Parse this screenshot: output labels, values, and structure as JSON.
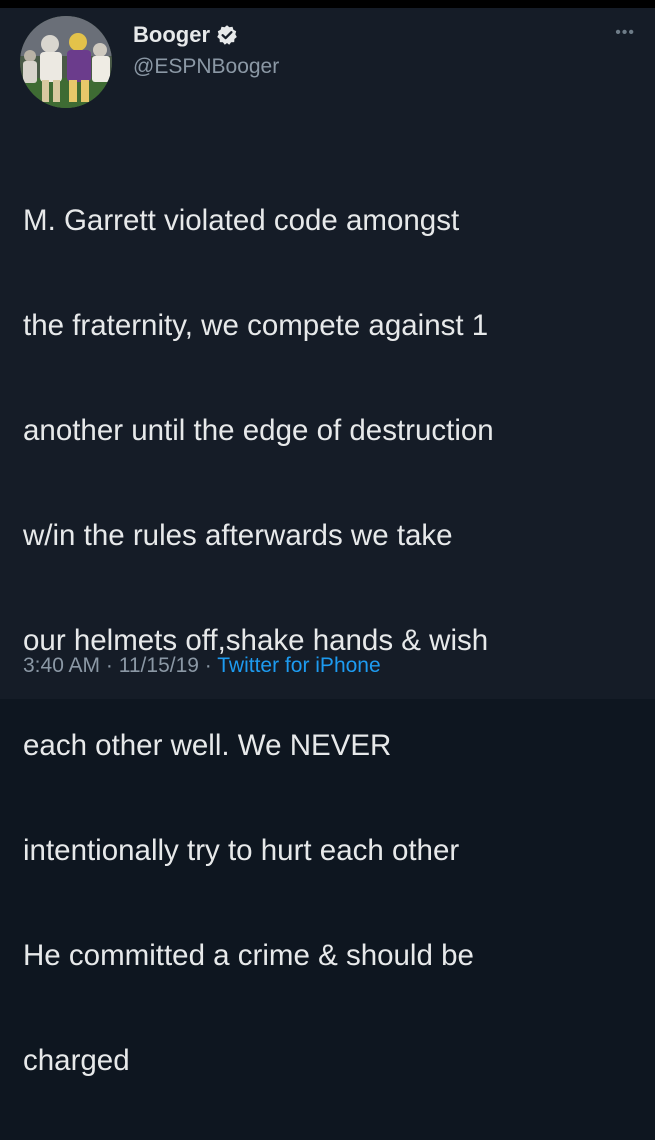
{
  "tweet": {
    "author": {
      "display_name": "Booger",
      "handle": "@ESPNBooger",
      "verified": true,
      "avatar_icon": "profile-photo-football"
    },
    "text_lines": [
      "M. Garrett violated code amongst",
      "the fraternity, we compete against 1",
      "another until the edge of destruction",
      "w/in the rules afterwards we take",
      "our helmets off,shake hands & wish",
      "each other well. We NEVER",
      "intentionally try to hurt each other",
      "He committed a crime & should be",
      "charged"
    ],
    "time": "3:40 AM",
    "date": "11/15/19",
    "separator": "·",
    "source": "Twitter for iPhone",
    "more_icon": "more-dots-icon"
  },
  "colors": {
    "background": "#151c27",
    "text": "#e7e9ea",
    "secondary": "#8b98a5",
    "accent": "#1d9bf0"
  }
}
